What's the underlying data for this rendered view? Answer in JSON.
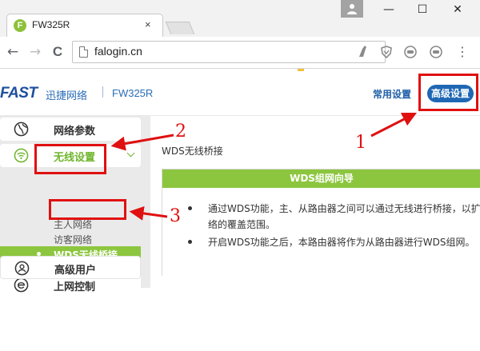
{
  "browser": {
    "tab_title": "FW325R",
    "tab_favicon_letter": "F",
    "tab_close": "×",
    "url": "falogin.cn",
    "window_minimize": "—",
    "window_maximize": "☐",
    "window_close": "✕",
    "nav_back": "←",
    "nav_forward": "→",
    "nav_reload": "C",
    "menu_icon": "⋮"
  },
  "header": {
    "logo": "FAST",
    "brand": "迅捷网络",
    "model": "FW325R",
    "link_common": "常用设置",
    "button_advanced": "高级设置"
  },
  "sidebar": {
    "items": [
      {
        "label": "网络参数",
        "icon": "globe-icon"
      },
      {
        "label": "无线设置",
        "icon": "wifi-icon",
        "active": true
      },
      {
        "label": "上网控制",
        "icon": "e-icon"
      },
      {
        "label": "高级用户",
        "icon": "user-icon"
      }
    ],
    "wireless_sub": [
      "主人网络",
      "访客网络",
      "WDS无线桥接"
    ]
  },
  "content": {
    "title": "WDS无线桥接",
    "wizard_title": "WDS组网向导",
    "bullet1_line1": "通过WDS功能，主、从路由器之间可以通过无线进行桥接，以扩",
    "bullet1_line2": "络的覆盖范围。",
    "bullet2": "开启WDS功能之后，本路由器将作为从路由器进行WDS组网。"
  },
  "annotations": {
    "labels": [
      "1",
      "2",
      "3"
    ],
    "color": "#e01010"
  },
  "colors": {
    "accent_green": "#8cc63f",
    "brand_blue": "#1f67b4",
    "annotation_red": "#e01010"
  }
}
